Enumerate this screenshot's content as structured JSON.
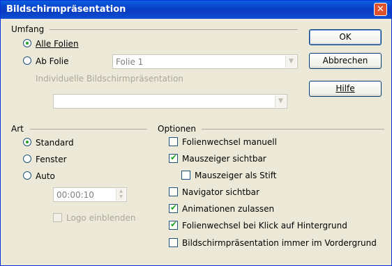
{
  "window": {
    "title": "Bildschirmpräsentation",
    "close_glyph": "✕"
  },
  "umfang": {
    "label": "Umfang",
    "alle_folien": "Alle Folien",
    "ab_folie": "Ab Folie",
    "ab_folie_value": "Folie 1",
    "individuell": "Individuelle Bildschirmpräsentation",
    "individuell_value": "",
    "selected": "alle_folien"
  },
  "buttons": {
    "ok": "OK",
    "abbrechen": "Abbrechen",
    "hilfe": "Hilfe"
  },
  "art": {
    "label": "Art",
    "standard": "Standard",
    "fenster": "Fenster",
    "auto": "Auto",
    "pause_value": "00:00:10",
    "logo": "Logo einblenden",
    "selected": "standard"
  },
  "optionen": {
    "label": "Optionen",
    "items": [
      {
        "label": "Folienwechsel manuell",
        "checked": false
      },
      {
        "label": "Mauszeiger sichtbar",
        "checked": true
      },
      {
        "label": "Mauszeiger als Stift",
        "checked": false
      },
      {
        "label": "Navigator sichtbar",
        "checked": false
      },
      {
        "label": "Animationen zulassen",
        "checked": true
      },
      {
        "label": "Folienwechsel bei Klick auf Hintergrund",
        "checked": true
      },
      {
        "label": "Bildschirmpräsentation immer im Vordergrund",
        "checked": false
      }
    ]
  }
}
